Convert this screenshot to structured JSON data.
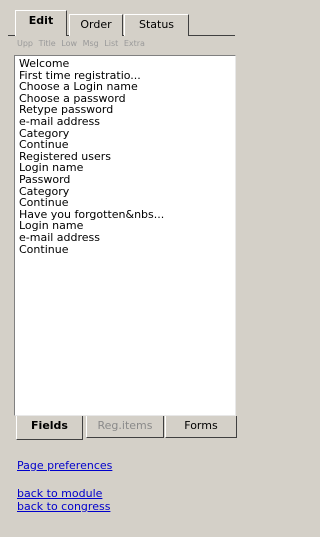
{
  "tabs": {
    "edit": "Edit",
    "order": "Order",
    "status": "Status"
  },
  "filters": [
    "Upp",
    "Title",
    "Low",
    "Msg",
    "List",
    "Extra"
  ],
  "items": [
    "Welcome",
    "First time registratio...",
    "Choose a Login name",
    "Choose a password",
    "Retype password",
    "e-mail address",
    "Category",
    "Continue",
    "Registered users",
    "Login name",
    "Password",
    "Category",
    "Continue",
    "Have you forgotten&nbs...",
    "Login name",
    "e-mail address",
    "Continue"
  ],
  "bottom_tabs": {
    "fields": "Fields",
    "reg_items": "Reg.items",
    "forms": "Forms"
  },
  "links": {
    "page_preferences": "Page preferences",
    "back_to_module": "back to module",
    "back_to_congress": "back to congress"
  }
}
